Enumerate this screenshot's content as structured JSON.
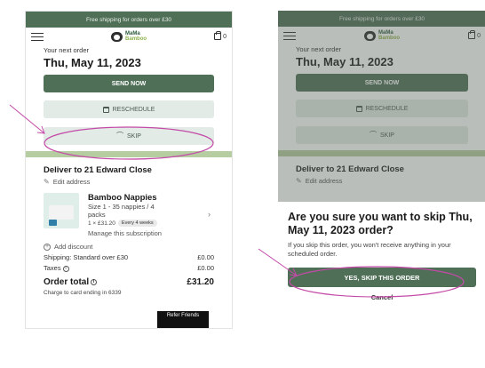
{
  "banner": {
    "text": "Free shipping for orders over £30"
  },
  "header": {
    "logo_line1": "MaMa",
    "logo_line2": "Bamboo",
    "cart_count": "0"
  },
  "order": {
    "next_label": "Your next order",
    "date": "Thu, May 11, 2023",
    "send_now": "SEND NOW",
    "reschedule": "RESCHEDULE",
    "skip": "SKIP"
  },
  "delivery": {
    "title": "Deliver to 21 Edward Close",
    "edit": "Edit address"
  },
  "product": {
    "name": "Bamboo Nappies",
    "size_line1": "Size 1 - 35 nappies / 4",
    "size_line2": "packs",
    "price": "1 × £31.20",
    "frequency": "Every 4 weeks",
    "manage": "Manage this subscription"
  },
  "summary": {
    "add_discount": "Add discount",
    "shipping_label": "Shipping: Standard over £30",
    "shipping_value": "£0.00",
    "taxes_label": "Taxes",
    "taxes_value": "£0.00",
    "total_label": "Order total",
    "total_value": "£31.20",
    "charge_text": "Charge to card ending in 6339"
  },
  "refer": {
    "label": "Refer Friends"
  },
  "dialog": {
    "title": "Are you sure you want to skip Thu, May 11, 2023 order?",
    "body": "If you skip this order, you won't receive anything in your scheduled order.",
    "confirm": "YES, SKIP THIS ORDER",
    "cancel": "Cancel"
  },
  "colors": {
    "brand_green": "#4f6f57",
    "light_button": "#e2ebe6",
    "band_green": "#b6cca1",
    "annotation": "#c44aa8"
  }
}
